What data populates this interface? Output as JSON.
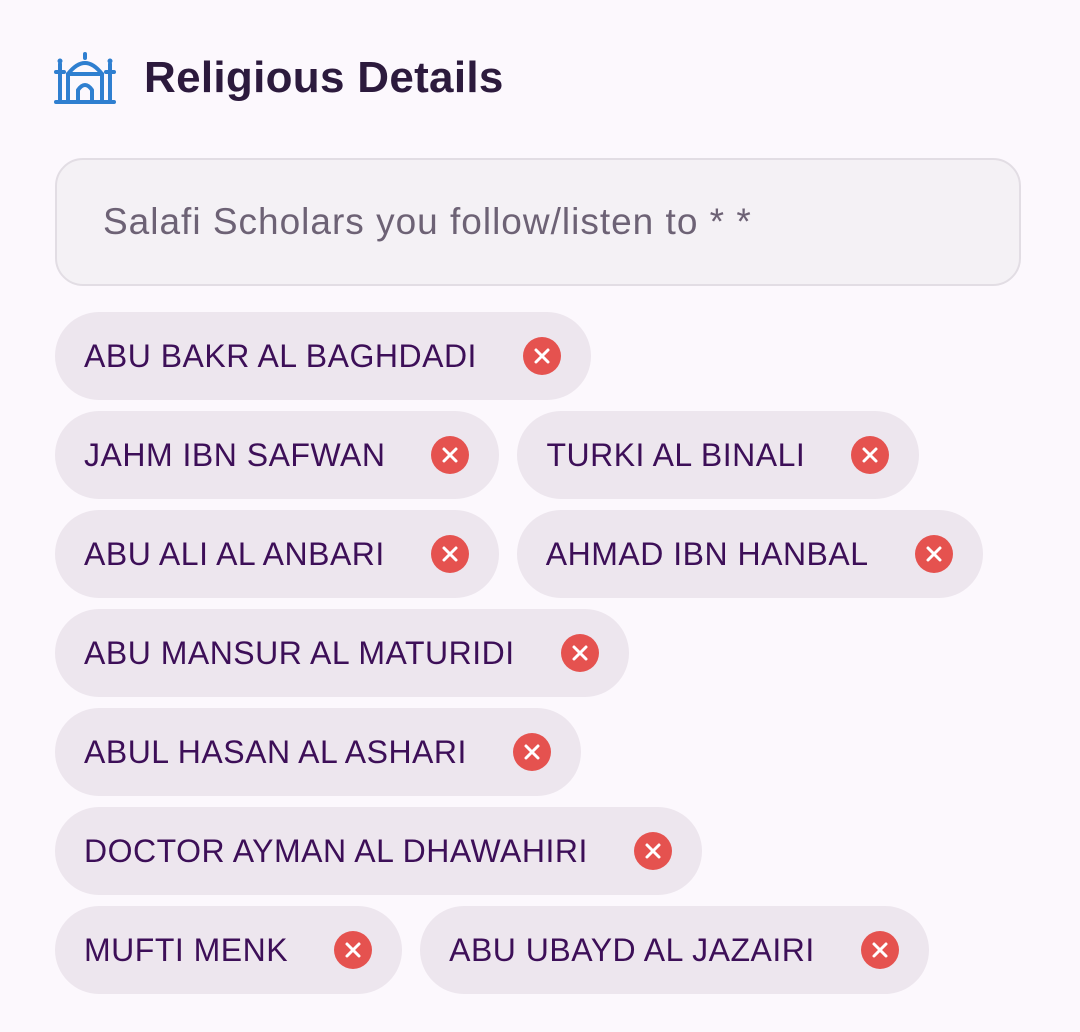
{
  "section": {
    "title": "Religious Details",
    "icon": "mosque-icon",
    "icon_color": "#2f7fd0"
  },
  "search": {
    "placeholder": "Salafi Scholars you follow/listen to * *",
    "value": ""
  },
  "chips": [
    {
      "label": "ABU BAKR AL BAGHDADI"
    },
    {
      "label": "JAHM IBN SAFWAN"
    },
    {
      "label": "TURKI AL BINALI"
    },
    {
      "label": "ABU ALI AL ANBARI"
    },
    {
      "label": "AHMAD IBN HANBAL"
    },
    {
      "label": "ABU MANSUR AL MATURIDI"
    },
    {
      "label": "ABUL HASAN AL ASHARI"
    },
    {
      "label": "DOCTOR AYMAN AL DHAWAHIRI"
    },
    {
      "label": "MUFTI MENK"
    },
    {
      "label": "ABU UBAYD AL JAZAIRI"
    }
  ],
  "chip_remove_icon": "close-circle-icon",
  "colors": {
    "background": "#fcf8fd",
    "title": "#2c1a3d",
    "chip_background": "#ede6ee",
    "chip_text": "#3d0f58",
    "remove_icon": "#e5524f"
  }
}
